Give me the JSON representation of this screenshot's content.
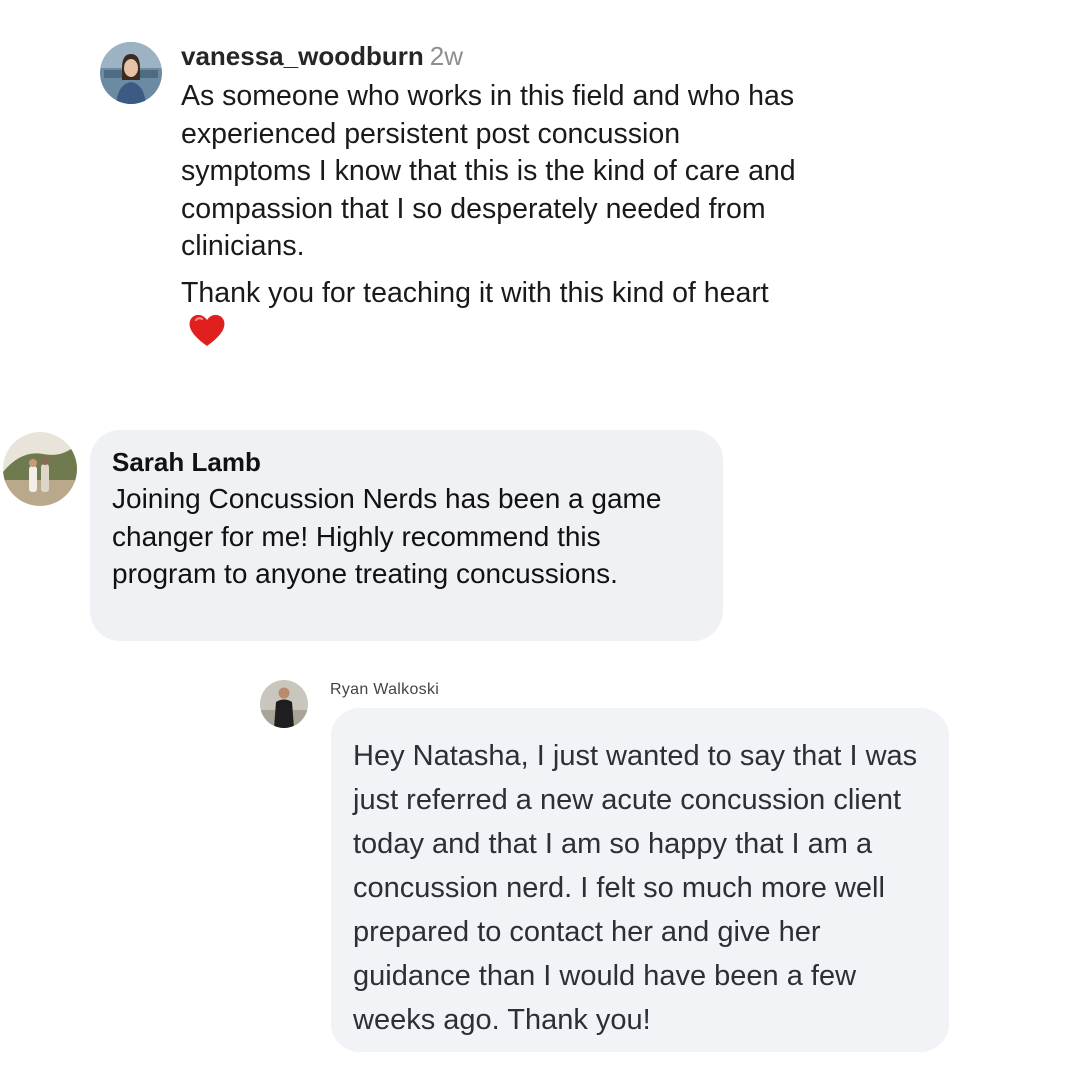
{
  "comments": [
    {
      "username": "vanessa_woodburn",
      "time": "2w",
      "paragraph1": "As someone who works in this field and who has experienced persistent post concussion symptoms I know that this is the kind of care and compassion that I so desperately needed from clinicians.",
      "paragraph2": "Thank you for teaching it with this kind of heart",
      "emoji": "red-heart"
    },
    {
      "name": "Sarah Lamb",
      "text": "Joining Concussion Nerds has been a game changer for me! Highly recommend this program to anyone treating concussions."
    },
    {
      "name": "Ryan Walkoski",
      "text": "Hey Natasha, I just wanted to say that I was just referred a new acute concussion client today and that I am so happy that I am a concussion nerd. I felt so much more well prepared to contact her and give her guidance than I would have been a few weeks ago. Thank you!"
    }
  ],
  "colors": {
    "bubble": "#f0f1f4",
    "timestamp": "#8e8e8e",
    "heart": "#e0201f"
  }
}
